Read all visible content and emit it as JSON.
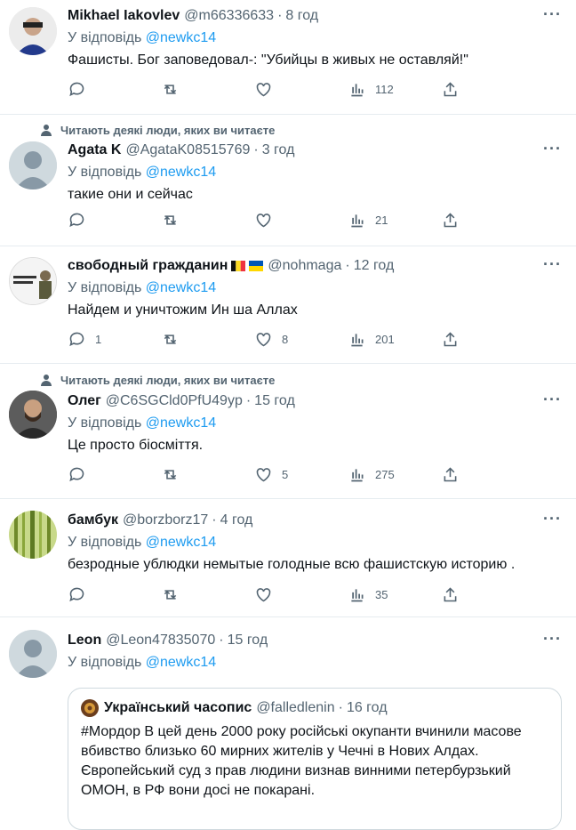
{
  "tweets": [
    {
      "name": "Mikhael Iakovlev",
      "handle": "@m66336633",
      "time": "8 год",
      "reply_prefix": "У відповідь",
      "reply_to": "@newkc14",
      "text": "Фашисты. Бог заповедовал-: \"Убийцы в живых не оставляй!\"",
      "replies": "",
      "retweets": "",
      "likes": "",
      "views": "112",
      "social": ""
    },
    {
      "name": "Agata K",
      "handle": "@AgataK08515769",
      "time": "3 год",
      "reply_prefix": "У відповідь",
      "reply_to": "@newkc14",
      "text": "такие они и сейчас",
      "replies": "",
      "retweets": "",
      "likes": "",
      "views": "21",
      "social": "Читають деякі люди, яких ви читаєте"
    },
    {
      "name": "свободный гражданин",
      "handle": "@nohmaga",
      "time": "12 год",
      "reply_prefix": "У відповідь",
      "reply_to": "@newkc14",
      "text": "Найдем и уничтожим Ин ша Аллах",
      "replies": "1",
      "retweets": "",
      "likes": "8",
      "views": "201",
      "social": ""
    },
    {
      "name": "Олег",
      "handle": "@C6SGCld0PfU49yp",
      "time": "15 год",
      "reply_prefix": "У відповідь",
      "reply_to": "@newkc14",
      "text": "Це просто біосміття.",
      "replies": "",
      "retweets": "",
      "likes": "5",
      "views": "275",
      "social": "Читають деякі люди, яких ви читаєте"
    },
    {
      "name": "бамбук",
      "handle": "@borzborz17",
      "time": "4 год",
      "reply_prefix": "У відповідь",
      "reply_to": "@newkc14",
      "text": "безродные ублюдки немытые голодные всю фашистскую историю .",
      "replies": "",
      "retweets": "",
      "likes": "",
      "views": "35",
      "social": ""
    },
    {
      "name": "Leon",
      "handle": "@Leon47835070",
      "time": "15 год",
      "reply_prefix": "У відповідь",
      "reply_to": "@newkc14",
      "text": "",
      "social": ""
    }
  ],
  "quote": {
    "name": "Український часопис",
    "handle": "@falledlenin",
    "time": "16 год",
    "text": "#Мордор В цей день 2000 року російські окупанти вчинили масове вбивство близько 60 мирних жителів у Чечні в Нових Алдах. Європейський суд з прав людини визнав винними петербурзький ОМОН, в РФ вони досі не покарані."
  },
  "colors": {
    "accent": "#1d9bf0",
    "muted": "#536471",
    "border": "#e6ecf0"
  }
}
